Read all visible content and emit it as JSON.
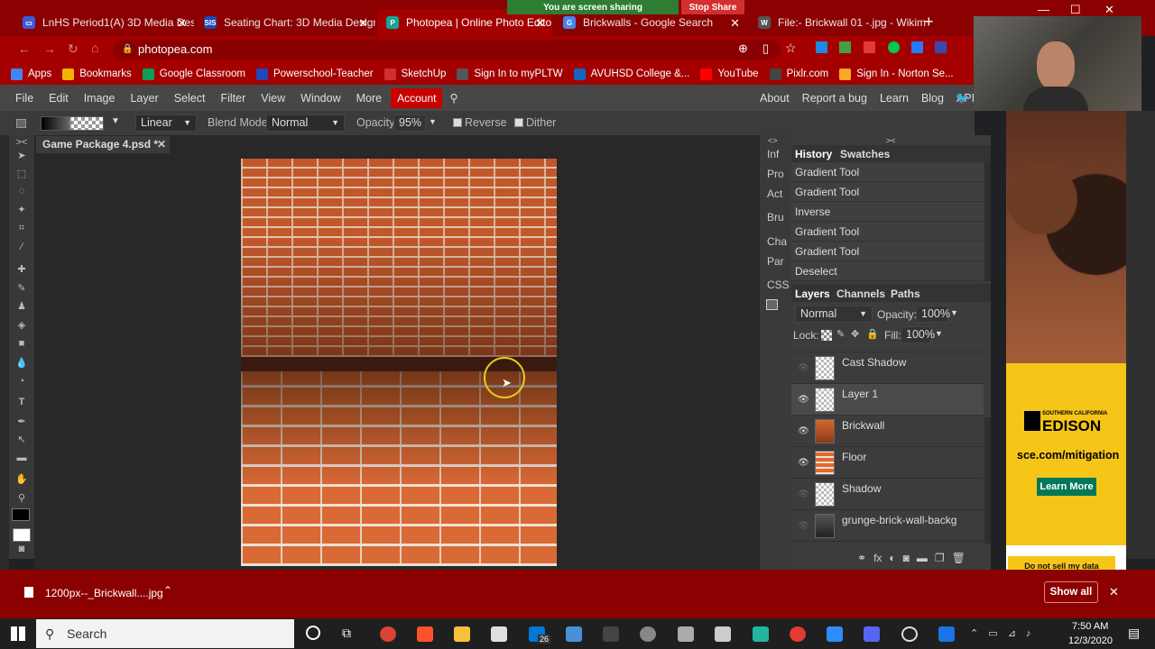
{
  "browser": {
    "tabs": [
      {
        "title": "LnHS Period1(A) 3D Media Desig",
        "color": "#3b5bdb",
        "icon_text": "▭"
      },
      {
        "title": "Seating Chart: 3D Media Design",
        "color": "#2148b8",
        "icon_text": "SIS"
      },
      {
        "title": "Photopea | Online Photo Editor",
        "color": "#18a497",
        "icon_text": "P"
      },
      {
        "title": "Brickwalls - Google Search",
        "color": "#4285f4",
        "icon_text": "G"
      },
      {
        "title": "File:- Brickwall 01 -.jpg - Wikimed",
        "color": "#555555",
        "icon_text": "W"
      }
    ],
    "sharing_text": "You are screen sharing",
    "stop_share": "Stop Share",
    "url": "photopea.com",
    "bookmarks": [
      {
        "label": "Apps",
        "color": "#4285f4"
      },
      {
        "label": "Bookmarks",
        "color": "#f4b400"
      },
      {
        "label": "Google Classroom",
        "color": "#0f9d58"
      },
      {
        "label": "Powerschool-Teacher",
        "color": "#2148b8"
      },
      {
        "label": "SketchUp",
        "color": "#d32f2f"
      },
      {
        "label": "Sign In to myPLTW",
        "color": "#555555"
      },
      {
        "label": "AVUHSD College &...",
        "color": "#1565c0"
      },
      {
        "label": "YouTube",
        "color": "#ff0000"
      },
      {
        "label": "Pixlr.com",
        "color": "#444444"
      },
      {
        "label": "Sign In - Norton Se...",
        "color": "#f9a825"
      }
    ]
  },
  "app": {
    "menus": [
      "File",
      "Edit",
      "Image",
      "Layer",
      "Select",
      "Filter",
      "View",
      "Window",
      "More"
    ],
    "account": "Account",
    "right_links": [
      "About",
      "Report a bug",
      "Learn",
      "Blog",
      "API"
    ],
    "options": {
      "gradient_type": "Linear",
      "blend_label": "Blend Mode:",
      "blend_value": "Normal",
      "opacity_label": "Opacity:",
      "opacity_value": "95%",
      "reverse": "Reverse",
      "dither": "Dither"
    },
    "document_tab": "Game Package 4.psd *",
    "side_tabs": [
      "Inf",
      "Pro",
      "Act",
      "Bru",
      "Cha",
      "Par",
      "CSS"
    ],
    "history_tabs": [
      "History",
      "Swatches"
    ],
    "history_items": [
      "Gradient Tool",
      "Gradient Tool",
      "Inverse",
      "Gradient Tool",
      "Gradient Tool",
      "Deselect"
    ],
    "layer_tabs": [
      "Layers",
      "Channels",
      "Paths"
    ],
    "layer_blend": "Normal",
    "layer_opacity_label": "Opacity:",
    "layer_opacity": "100%",
    "lock_label": "Lock:",
    "fill_label": "Fill:",
    "fill_value": "100%",
    "layers": [
      {
        "name": "Cast Shadow",
        "visible": false,
        "selected": false
      },
      {
        "name": "Layer 1",
        "visible": true,
        "selected": true
      },
      {
        "name": "Brickwall",
        "visible": true,
        "selected": false
      },
      {
        "name": "Floor",
        "visible": true,
        "selected": false
      },
      {
        "name": "Shadow",
        "visible": false,
        "selected": false
      },
      {
        "name": "grunge-brick-wall-backg",
        "visible": false,
        "selected": false
      }
    ]
  },
  "ad": {
    "brand_small": "SOUTHERN CALIFORNIA",
    "brand": "EDISON",
    "url": "sce.com/mitigation",
    "cta": "Learn More",
    "footer": "Do not sell my data"
  },
  "download": {
    "filename": "1200px--_Brickwall....jpg",
    "show_all": "Show all"
  },
  "taskbar": {
    "search": "Search",
    "time": "7:50 AM",
    "date": "12/3/2020",
    "mail_badge": "26"
  }
}
